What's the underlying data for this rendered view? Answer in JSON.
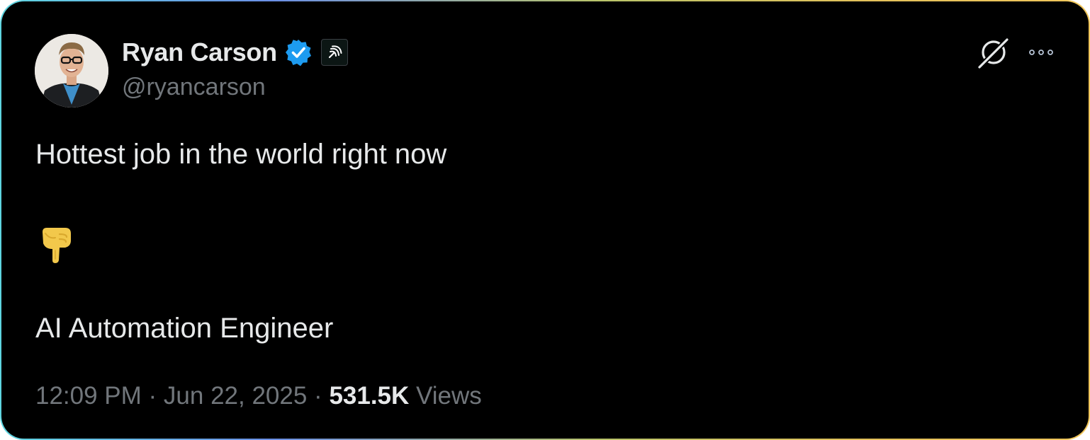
{
  "author": {
    "display_name": "Ryan Carson",
    "handle": "@ryancarson",
    "verified": true,
    "verified_color": "#1d9bf0"
  },
  "header_actions": {
    "grok_icon": "grok-icon",
    "more_icon": "more-icon"
  },
  "tweet": {
    "line1": "Hottest job in the world right now",
    "emoji": "👇",
    "line3": "AI Automation Engineer"
  },
  "meta": {
    "time": "12:09 PM",
    "separator": " · ",
    "date": "Jun 22, 2025",
    "views_count": "531.5K",
    "views_label": "Views"
  },
  "colors": {
    "background": "#000000",
    "primary_text": "#e7e9ea",
    "secondary_text": "#71767b",
    "accent": "#1d9bf0"
  }
}
